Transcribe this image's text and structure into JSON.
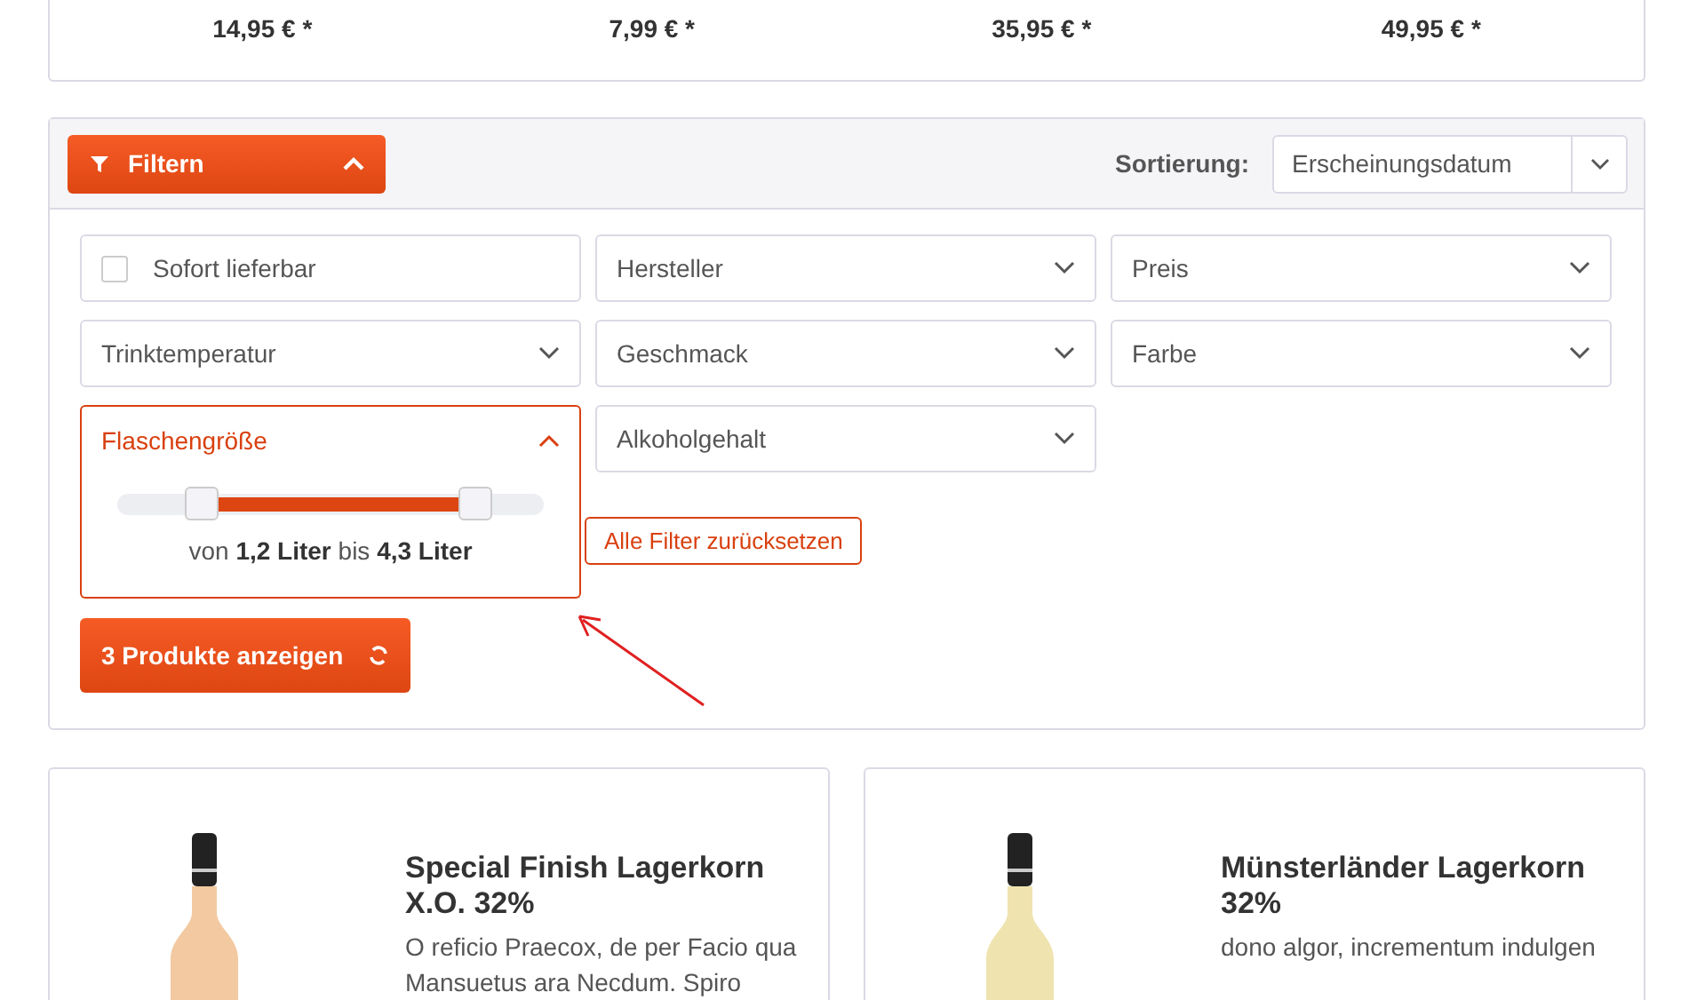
{
  "top_prices": [
    "14,95 € *",
    "7,99 € *",
    "35,95 € *",
    "49,95 € *"
  ],
  "filter_bar": {
    "toggle": {
      "label": "Filtern",
      "expanded": true
    },
    "sort_label": "Sortierung:",
    "sort_value": "Erscheinungsdatum"
  },
  "filters": [
    {
      "kind": "checkbox",
      "label": "Sofort lieferbar",
      "checked": false
    },
    {
      "kind": "dropdown",
      "label": "Hersteller",
      "expanded": false
    },
    {
      "kind": "dropdown",
      "label": "Preis",
      "expanded": false
    },
    {
      "kind": "dropdown",
      "label": "Trinktemperatur",
      "expanded": false
    },
    {
      "kind": "dropdown",
      "label": "Geschmack",
      "expanded": false
    },
    {
      "kind": "dropdown",
      "label": "Farbe",
      "expanded": false
    },
    {
      "kind": "range",
      "label": "Flaschengröße",
      "expanded": true,
      "low": {
        "level": 0.2
      },
      "high": {
        "level": 0.84
      },
      "reading": "von **1,2 Liter** bis **4,3 Liter**"
    },
    {
      "kind": "dropdown",
      "label": "Alkoholgehalt",
      "expanded": false
    }
  ],
  "reset_button": "Alle Filter zurücksetzen",
  "show_button": "3 Produkte anzeigen",
  "products": [
    {
      "title": "Special Finish Lagerkorn X.O. 32%",
      "description": [
        "O reficio Praecox, de per Facio qua",
        "Mansuetus ara Necdum. Spiro"
      ]
    },
    {
      "title": "Münsterländer Lagerkorn 32%",
      "description": [
        "dono algor, incrementum indulgen"
      ]
    }
  ]
}
